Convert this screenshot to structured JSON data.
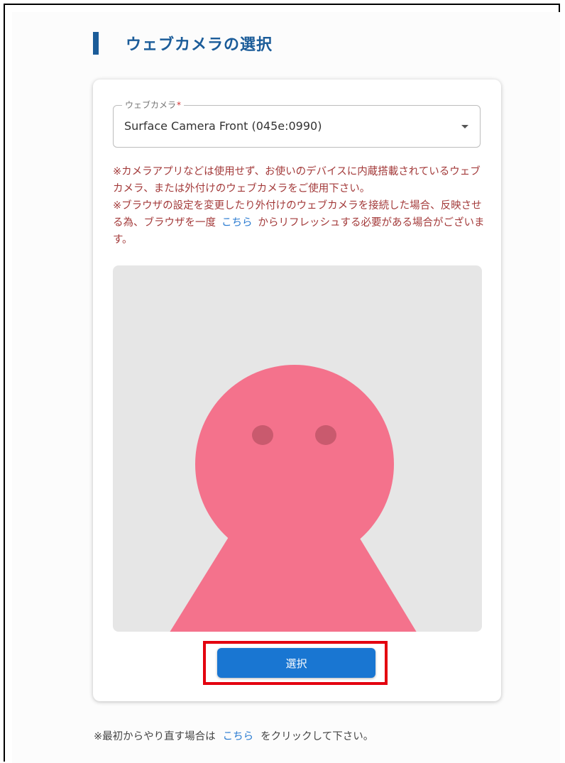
{
  "heading": {
    "title": "ウェブカメラの選択",
    "accent_color": "#1b5c99"
  },
  "camera_select": {
    "label": "ウェブカメラ",
    "required_mark": "*",
    "selected_value": "Surface Camera Front (045e:0990)"
  },
  "notice": {
    "line1": "※カメラアプリなどは使用せず、お使いのデバイスに内蔵搭載されているウェブカメラ、または外付けのウェブカメラをご使用下さい。",
    "line2_before": "※ブラウザの設定を変更したり外付けのウェブカメラを接続した場合、反映させる為、ブラウザを一度",
    "line2_link": "こちら",
    "line2_after": "からリフレッシュする必要がある場合がございます。",
    "color": "#a33a3a"
  },
  "preview": {
    "placeholder_icon": "person-silhouette-icon",
    "figure_color": "#f4728c",
    "eye_color": "#c95a6e"
  },
  "select_button": {
    "label": "選択",
    "color": "#1976d2"
  },
  "footer": {
    "text_before": "※最初からやり直す場合は",
    "link": "こちら",
    "text_after": "をクリックして下さい。"
  }
}
